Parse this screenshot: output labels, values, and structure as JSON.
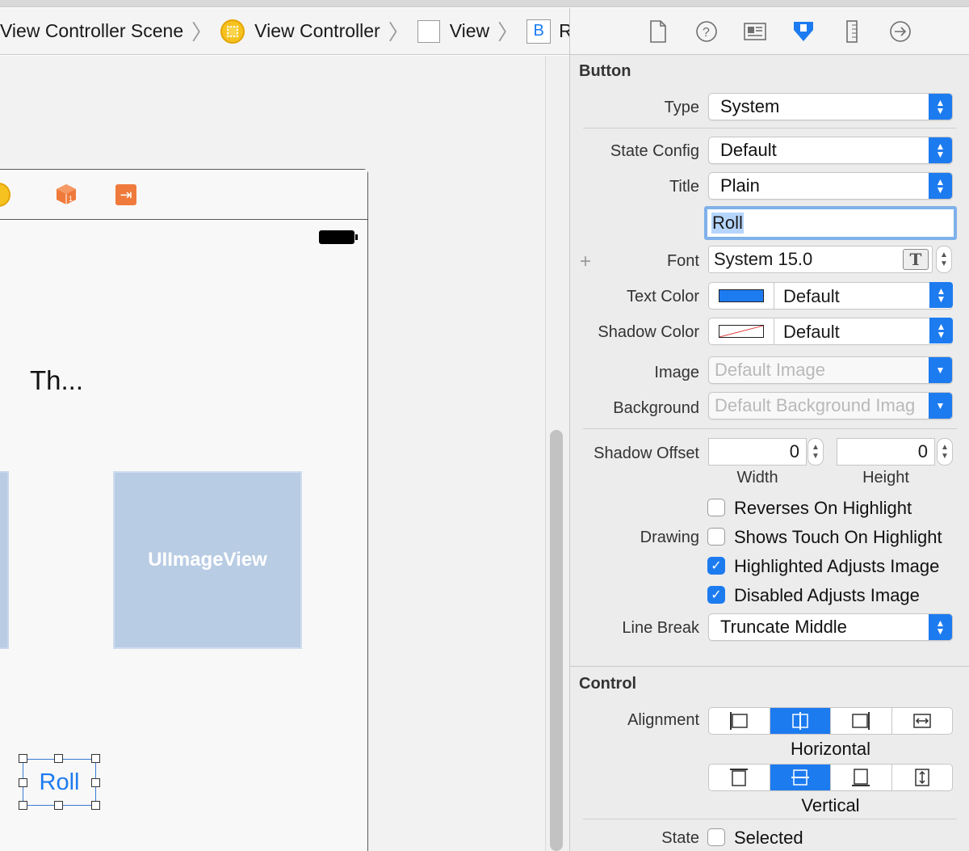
{
  "breadcrumb": {
    "items": [
      {
        "label": "View Controller Scene"
      },
      {
        "label": "View Controller"
      },
      {
        "label": "View"
      },
      {
        "label": "Roll",
        "badge": "B"
      }
    ]
  },
  "canvas": {
    "label_text": "Th...",
    "image_view_label": "UIImageView",
    "button_label": "Roll"
  },
  "inspector": {
    "button_section": {
      "title": "Button",
      "type_label": "Type",
      "type_value": "System",
      "state_config_label": "State Config",
      "state_config_value": "Default",
      "title_label": "Title",
      "title_value": "Plain",
      "title_text": "Roll",
      "font_label": "Font",
      "font_value": "System 15.0",
      "font_button_glyph": "T",
      "text_color_label": "Text Color",
      "text_color_value": "Default",
      "text_color_swatch": "#1d7bf0",
      "shadow_color_label": "Shadow Color",
      "shadow_color_value": "Default",
      "image_label": "Image",
      "image_placeholder": "Default Image",
      "background_label": "Background",
      "background_placeholder": "Default Background Imag",
      "shadow_offset_label": "Shadow Offset",
      "shadow_width": "0",
      "shadow_height": "0",
      "width_label": "Width",
      "height_label": "Height",
      "drawing_label": "Drawing",
      "drawing_options": [
        {
          "label": "Reverses On Highlight",
          "checked": false
        },
        {
          "label": "Shows Touch On Highlight",
          "checked": false
        },
        {
          "label": "Highlighted Adjusts Image",
          "checked": true
        },
        {
          "label": "Disabled Adjusts Image",
          "checked": true
        }
      ],
      "line_break_label": "Line Break",
      "line_break_value": "Truncate Middle"
    },
    "control_section": {
      "title": "Control",
      "alignment_label": "Alignment",
      "horizontal_label": "Horizontal",
      "vertical_label": "Vertical",
      "horizontal_selected_index": 1,
      "vertical_selected_index": 1,
      "state_label": "State",
      "selected_label": "Selected",
      "selected_checked": false
    }
  },
  "colors": {
    "accent": "#1d7bf0",
    "image_view_fill": "#b8cce4",
    "orange_icon": "#ef7a3b",
    "yellow_icon": "#f6c21f"
  }
}
